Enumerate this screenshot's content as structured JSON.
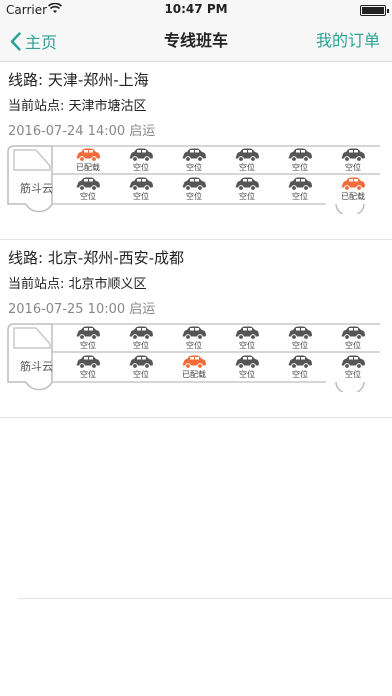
{
  "status": {
    "carrier": "Carrier",
    "time": "10:47 PM"
  },
  "nav": {
    "back_label": "主页",
    "title": "专线班车",
    "right_label": "我的订单"
  },
  "colors": {
    "accent": "#2ba293",
    "booked": "#f26b3a",
    "empty": "#555555"
  },
  "cards": [
    {
      "route": "线路: 天津-郑州-上海",
      "station": "当前站点: 天津市塘沽区",
      "date": "2016-07-24 14:00 启运",
      "brand": "筋斗云",
      "top_row": [
        {
          "label": "已配载",
          "booked": true
        },
        {
          "label": "空位",
          "booked": false
        },
        {
          "label": "空位",
          "booked": false
        },
        {
          "label": "空位",
          "booked": false
        },
        {
          "label": "空位",
          "booked": false
        },
        {
          "label": "空位",
          "booked": false
        }
      ],
      "bottom_row": [
        {
          "label": "空位",
          "booked": false
        },
        {
          "label": "空位",
          "booked": false
        },
        {
          "label": "空位",
          "booked": false
        },
        {
          "label": "空位",
          "booked": false
        },
        {
          "label": "空位",
          "booked": false
        },
        {
          "label": "已配载",
          "booked": true
        }
      ]
    },
    {
      "route": "线路: 北京-郑州-西安-成都",
      "station": "当前站点: 北京市顺义区",
      "date": "2016-07-25 10:00 启运",
      "brand": "筋斗云",
      "top_row": [
        {
          "label": "空位",
          "booked": false
        },
        {
          "label": "空位",
          "booked": false
        },
        {
          "label": "空位",
          "booked": false
        },
        {
          "label": "空位",
          "booked": false
        },
        {
          "label": "空位",
          "booked": false
        },
        {
          "label": "空位",
          "booked": false
        }
      ],
      "bottom_row": [
        {
          "label": "空位",
          "booked": false
        },
        {
          "label": "空位",
          "booked": false
        },
        {
          "label": "已配载",
          "booked": true
        },
        {
          "label": "空位",
          "booked": false
        },
        {
          "label": "空位",
          "booked": false
        },
        {
          "label": "空位",
          "booked": false
        }
      ]
    }
  ]
}
